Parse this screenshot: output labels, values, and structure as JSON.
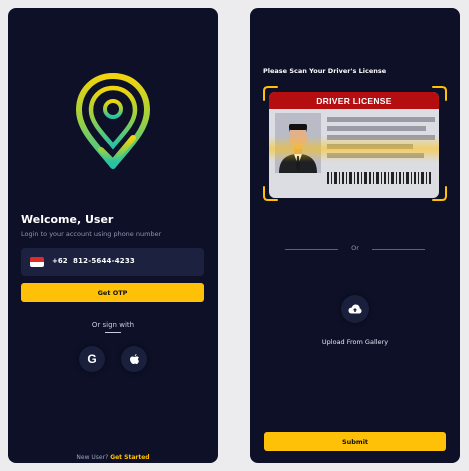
{
  "login": {
    "logo_icon": "location-pin-check-icon",
    "welcome_title": "Welcome, User",
    "welcome_subtitle": "Login to your account using phone number",
    "country_flag": "indonesia-flag-icon",
    "country_code": "+62",
    "phone_number": "812-5644-4233",
    "otp_button": "Get OTP",
    "or_sign_with": "Or sign with",
    "social": [
      {
        "icon": "google-icon",
        "glyph": "G"
      },
      {
        "icon": "apple-icon"
      }
    ],
    "footer_prefix": "New User?",
    "footer_link": "Get Started"
  },
  "scan": {
    "title": "Please Scan Your Driver's License",
    "license_header": "DRIVER LICENSE",
    "or_text": "Or",
    "upload_icon": "cloud-upload-icon",
    "upload_label": "Upload From Gallery",
    "submit_button": "Submit"
  },
  "colors": {
    "background": "#0d1027",
    "accent": "#ffc107",
    "input_bg": "#1c2140",
    "license_header": "#b40e10"
  }
}
